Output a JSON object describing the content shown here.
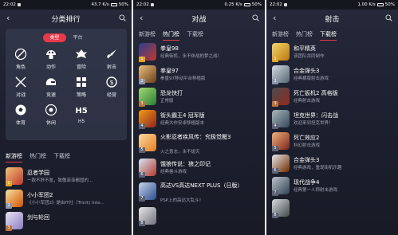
{
  "panels": [
    {
      "status": {
        "time": "22:02",
        "speed": "43.7 K/s",
        "battery": "50%"
      },
      "title": "分类排行",
      "segment": [
        "类型",
        "平台"
      ],
      "categories": [
        {
          "label": "角色",
          "icon": "sword-slash-icon"
        },
        {
          "label": "动作",
          "icon": "mushroom-icon"
        },
        {
          "label": "冒险",
          "icon": "dragon-icon"
        },
        {
          "label": "射击",
          "icon": "rocket-icon"
        },
        {
          "label": "对战",
          "icon": "crossed-swords-icon"
        },
        {
          "label": "竞速",
          "icon": "helmet-icon"
        },
        {
          "label": "策略",
          "icon": "strategy-grid-icon"
        },
        {
          "label": "经营",
          "icon": "coin-icon"
        },
        {
          "label": "体育",
          "icon": "ball-icon"
        },
        {
          "label": "休闲",
          "icon": "joystick-icon"
        },
        {
          "label": "H5",
          "icon": "h5-icon"
        }
      ],
      "tabs": [
        "新游榜",
        "热门榜",
        "下载榜"
      ],
      "active_tab": 0,
      "games": [
        {
          "rank": "1",
          "name": "忍者学园",
          "desc": "一款不肝不氪，致敬菲菲都国的..."
        },
        {
          "rank": "2",
          "name": "小小军团2",
          "desc": "《小小军团2》是由IT社（Trinit) Inte..."
        },
        {
          "rank": "3",
          "name": "剑与轮回",
          "desc": ""
        }
      ]
    },
    {
      "status": {
        "time": "22:02",
        "speed": "0.25 K/s",
        "battery": "50%"
      },
      "title": "对战",
      "tabs": [
        "新游榜",
        "热门榜",
        "下载榜"
      ],
      "active_tab": 1,
      "games": [
        {
          "rank": "1",
          "name": "拳皇98",
          "desc": "经典街机，永不休战的梦之战！"
        },
        {
          "rank": "2",
          "name": "拳皇97",
          "desc": "拳皇97移动平台移植版"
        },
        {
          "rank": "3",
          "name": "恐龙快打",
          "desc": "正常版"
        },
        {
          "rank": "4",
          "name": "街头霸王4 冠军版",
          "desc": "经典大作安卓移植版本"
        },
        {
          "rank": "5",
          "name": "火影忍者疾风传：究极觉醒3",
          "desc": "火之意志，永不熄灭"
        },
        {
          "rank": "6",
          "name": "饿狼传说：狼之印记",
          "desc": "经典格斗游戏"
        },
        {
          "rank": "7",
          "name": "高达VS高达NEXT PLUS（日版）",
          "desc": "PSP上的高达大乱斗！"
        },
        {
          "rank": "8",
          "name": "",
          "desc": ""
        }
      ]
    },
    {
      "status": {
        "time": "22:02",
        "speed": "1.00 K/s",
        "battery": "50%"
      },
      "title": "射击",
      "tabs": [
        "新游榜",
        "热门榜",
        "下载榜"
      ],
      "active_tab": 2,
      "games": [
        {
          "rank": "1",
          "name": "和平精英",
          "desc": "该团队共同制作"
        },
        {
          "rank": "2",
          "name": "合金弹头3",
          "desc": "经典横版射击游戏"
        },
        {
          "rank": "3",
          "name": "死亡扳机2 高格版",
          "desc": "经典射击游戏"
        },
        {
          "rank": "4",
          "name": "坦克世界：闪击战",
          "desc": "欢迎来到坦克世界！"
        },
        {
          "rank": "5",
          "name": "死亡效应2",
          "desc": "科幻射击游戏"
        },
        {
          "rank": "6",
          "name": "合金弹头3",
          "desc": "经典游戏，重现街机乐趣"
        },
        {
          "rank": "7",
          "name": "现代战争4",
          "desc": "经典第一人称射击游戏"
        },
        {
          "rank": "8",
          "name": "",
          "desc": ""
        }
      ]
    }
  ],
  "colors": {
    "accent": "#e8394a",
    "gold": "#e2a52b",
    "silver": "#8c96aa",
    "bronze": "#b9733f"
  }
}
